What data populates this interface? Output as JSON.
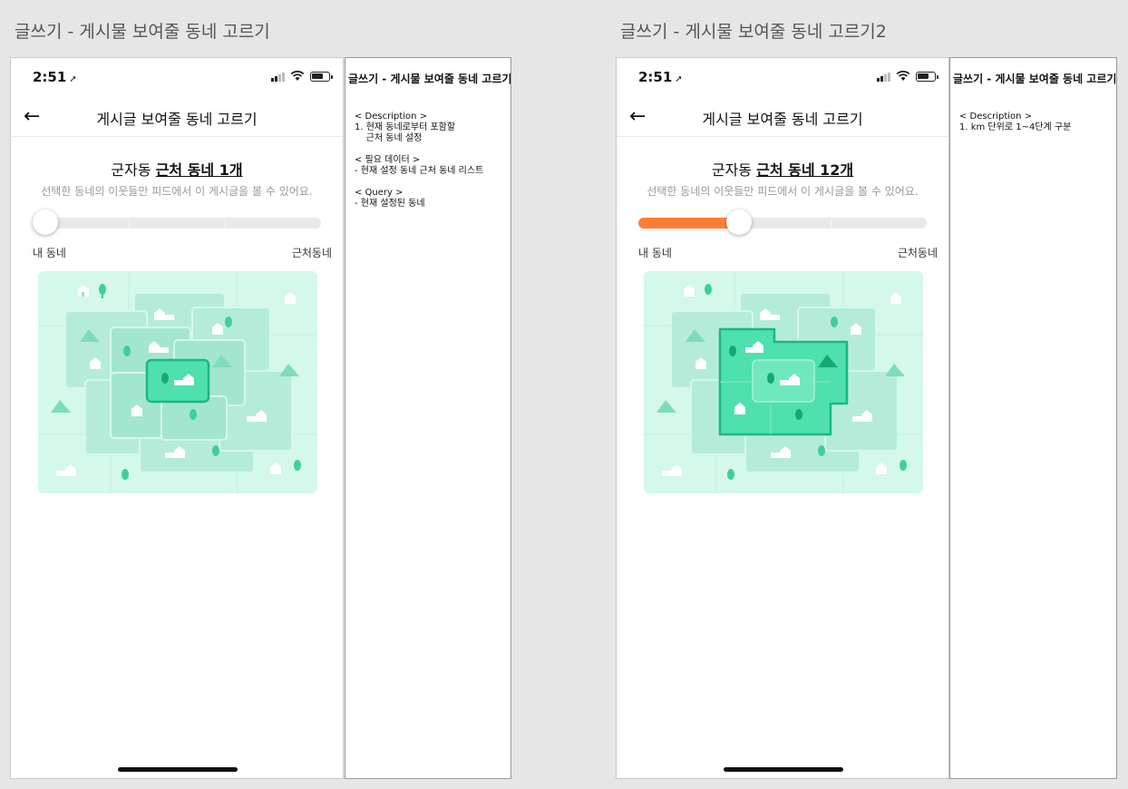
{
  "frames": [
    {
      "title": "글쓰기 - 게시물 보여줄 동네 고르기",
      "phone": {
        "time": "2:51",
        "nav_title": "게시글 보여줄 동네 고르기",
        "heading_prefix": "군자동",
        "heading_highlight": "근처 동네 1개",
        "subtitle": "선택한 동네의 이웃들만 피드에서 이 게시글을 볼 수 있어요.",
        "slider_fraction": 0,
        "label_left": "내 동네",
        "label_right": "근처동네"
      },
      "note": {
        "title": "글쓰기 - 게시물 보여줄 동네 고르기",
        "body": "< Description >\n1. 현재 동네로부터 포함할\n    근처 동네 설정\n\n< 필요 데이터 >\n- 현재 설정 동네 근처 동네 리스트\n\n< Query >\n- 현재 설정된 동네"
      }
    },
    {
      "title": "글쓰기 - 게시물 보여줄 동네 고르기2",
      "phone": {
        "time": "2:51",
        "nav_title": "게시글 보여줄 동네 고르기",
        "heading_prefix": "군자동",
        "heading_highlight": "근처 동네 12개",
        "subtitle": "선택한 동네의 이웃들만 피드에서 이 게시글을 볼 수 있어요.",
        "slider_fraction": 0.35,
        "label_left": "내 동네",
        "label_right": "근처동네"
      },
      "note": {
        "title": "글쓰기 - 게시물 보여줄 동네 고르기",
        "body": "< Description >\n1. km 단위로 1~4단계 구분"
      }
    }
  ],
  "colors": {
    "accent": "#ff7e36",
    "map_bg": "#d4f8ea",
    "map_tile": "#b5ecd9",
    "map_selected": "#4ee0ad",
    "map_border": "#19b882"
  },
  "icons": [
    "back-arrow-icon",
    "location-arrow-icon",
    "signal-icon",
    "wifi-icon",
    "battery-icon",
    "house-icon",
    "tree-icon",
    "mountain-icon"
  ]
}
